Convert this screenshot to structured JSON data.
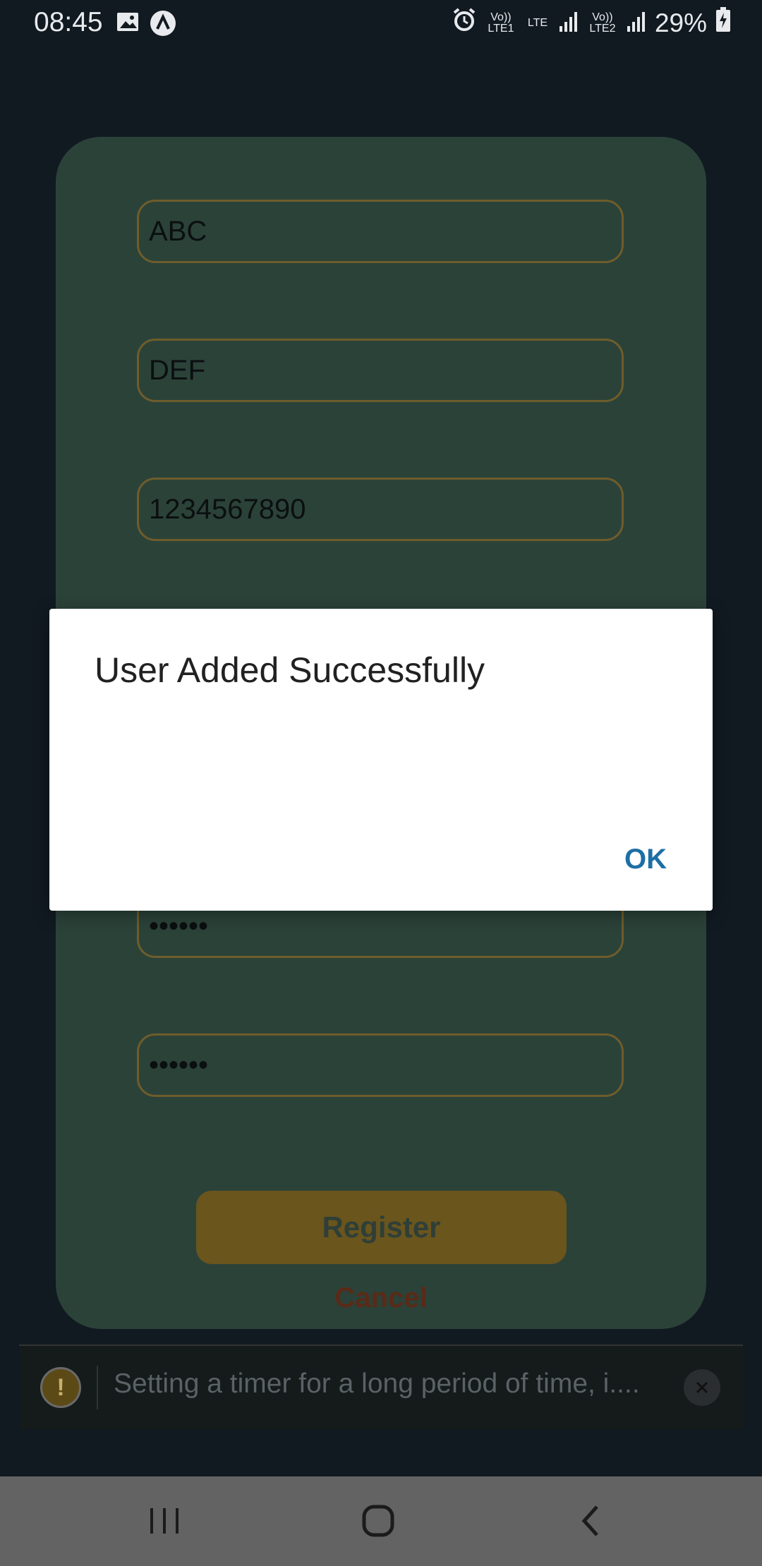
{
  "status_bar": {
    "time": "08:45",
    "battery": "29%",
    "sim1_label": "Vo)) LTE1",
    "lte_label": "LTE",
    "sim2_label": "Vo)) LTE2"
  },
  "form": {
    "first_name": "ABC",
    "last_name": "DEF",
    "phone": "1234567890",
    "password_mask": "••••••",
    "confirm_password_mask": "••••••",
    "register_label": "Register",
    "cancel_label": "Cancel"
  },
  "toast": {
    "message": "Setting a timer for a long period of time, i....",
    "icon_glyph": "!"
  },
  "dialog": {
    "title": "User Added Successfully",
    "ok_label": "OK"
  },
  "icons": [
    "image-icon",
    "app-logo-icon",
    "alarm-icon",
    "signal-icon",
    "battery-charging-icon",
    "warning-icon",
    "close-icon",
    "recent-apps-icon",
    "home-icon",
    "back-icon"
  ]
}
